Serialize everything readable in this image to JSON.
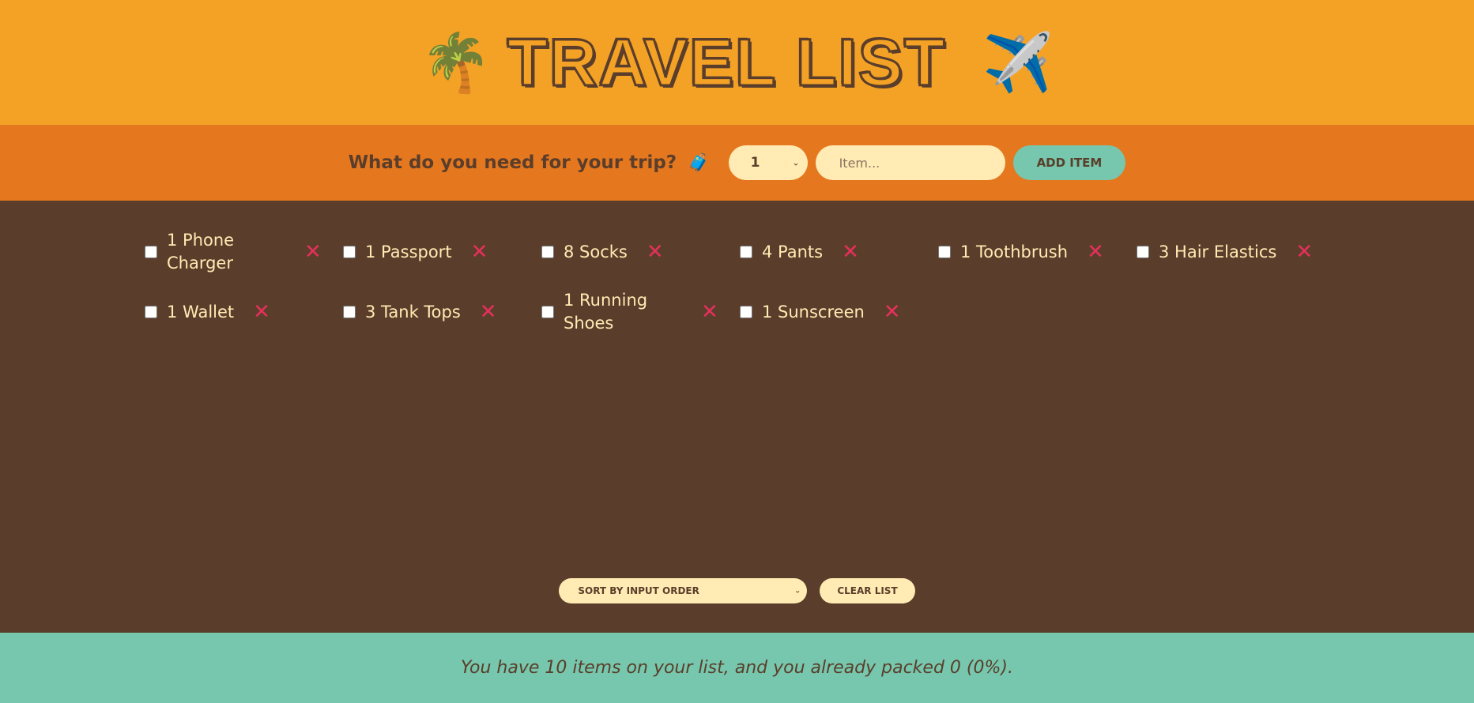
{
  "header": {
    "title": "TRAVEL LIST",
    "left_emoji": "🌴",
    "right_emoji": "✈️"
  },
  "form": {
    "question": "What do you need for your trip?",
    "question_emoji": "🧳",
    "quantity_selected": "1",
    "item_placeholder": "Item...",
    "add_label": "ADD ITEM"
  },
  "items": [
    {
      "quantity": 1,
      "description": "Phone Charger",
      "text": "1 Phone Charger",
      "packed": false
    },
    {
      "quantity": 1,
      "description": "Passport",
      "text": "1 Passport",
      "packed": false
    },
    {
      "quantity": 8,
      "description": "Socks",
      "text": "8 Socks",
      "packed": false
    },
    {
      "quantity": 4,
      "description": "Pants",
      "text": "4 Pants",
      "packed": false
    },
    {
      "quantity": 1,
      "description": "Toothbrush",
      "text": "1 Toothbrush",
      "packed": false
    },
    {
      "quantity": 3,
      "description": "Hair Elastics",
      "text": "3 Hair Elastics",
      "packed": false
    },
    {
      "quantity": 1,
      "description": "Wallet",
      "text": "1 Wallet",
      "packed": false
    },
    {
      "quantity": 3,
      "description": "Tank Tops",
      "text": "3 Tank Tops",
      "packed": false
    },
    {
      "quantity": 1,
      "description": "Running Shoes",
      "text": "1 Running Shoes",
      "packed": false
    },
    {
      "quantity": 1,
      "description": "Sunscreen",
      "text": "1 Sunscreen",
      "packed": false
    }
  ],
  "delete_glyph": "❌",
  "actions": {
    "sort_selected": "SORT BY INPUT ORDER",
    "clear_label": "CLEAR LIST"
  },
  "stats": {
    "text": "You have 10 items on your list, and you already packed 0 (0%)."
  },
  "colors": {
    "header_bg": "#f4a226",
    "form_bg": "#e5771e",
    "list_bg": "#5a3e2b",
    "stats_bg": "#76c7ad",
    "item_text": "#ffebb3",
    "delete": "#e5305b"
  },
  "icons": {
    "palm": "palm-tree-icon",
    "plane": "airplane-icon",
    "luggage": "luggage-icon",
    "delete": "close-icon",
    "dropdown": "chevron-down-icon"
  }
}
